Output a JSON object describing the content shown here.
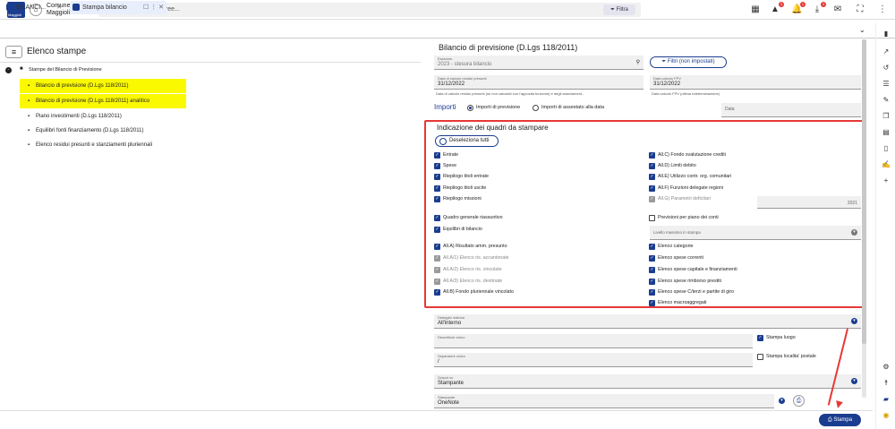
{
  "app": {
    "logo_text": "Maggioli",
    "name_line1": "Comune di",
    "name_line2": "Maggioli WEB",
    "search_placeholder": "Cerca in tutte le aree...",
    "filter_label": "Filtra",
    "badges": {
      "alerts": "3",
      "notifications": "1",
      "downloads": "3"
    }
  },
  "tabs": [
    {
      "label": "BILANCI..."
    },
    {
      "label": "Stampa bilancio"
    }
  ],
  "sidebar": {
    "title": "Elenco stampe",
    "root": "Stampe del Bilancio di Previsione",
    "items": [
      {
        "label": "Bilancio di previsione (D.Lgs 118/2011)"
      },
      {
        "label": "Bilancio di previsione (D.Lgs 118/2011) analitico"
      },
      {
        "label": "Piano investimenti (D.Lgs 118/2011)"
      },
      {
        "label": "Equilibri fonti finanziamento (D.Lgs 118/2011)"
      },
      {
        "label": "Elenco residui presunti e stanziamenti pluriennali"
      }
    ]
  },
  "form": {
    "title": "Bilancio di previsione (D.Lgs 118/2011)",
    "esercizio": {
      "label": "Esercizio",
      "value": "2023 - stesura bilancio"
    },
    "filter_btn": "Filtri (non impostati)",
    "residui": {
      "label": "Data di calcolo residui presunti",
      "value": "31/12/2022",
      "note": "Data di calcolo residui presunti (se non calcolati con l'apposita funzione) e degli stanziament..."
    },
    "fpv": {
      "label": "Data calcolo FPV",
      "value": "31/12/2022",
      "note": "Data calcolo FPV (ultima rideterminazione)"
    },
    "importi": {
      "label": "Importi",
      "opt1": "Importi di previsione",
      "opt2": "Importi di assestato alla data"
    },
    "data_label": "Data",
    "quadri": {
      "title": "Indicazione dei quadri da stampare",
      "deselect": "Deseleziona tutti",
      "left": [
        {
          "label": "Entrate",
          "state": "on"
        },
        {
          "label": "Spese",
          "state": "on"
        },
        {
          "label": "Riepilogo titoli entrate",
          "state": "on"
        },
        {
          "label": "Riepilogo titoli uscite",
          "state": "on"
        },
        {
          "label": "Riepilogo missioni",
          "state": "on"
        },
        {
          "label": "Quadro generale riassuntivo",
          "state": "on"
        },
        {
          "label": "Equilibri di bilancio",
          "state": "on"
        },
        {
          "label": "All.A) Risultato amm. presunto",
          "state": "on"
        },
        {
          "label": "All.A/1) Elenco ris. accantonate",
          "state": "dis"
        },
        {
          "label": "All.A/2) Elenco ris. vincolate",
          "state": "dis"
        },
        {
          "label": "All.A/3) Elenco ris. destinate",
          "state": "dis"
        },
        {
          "label": "All.B) Fondo pluriennale vincolato",
          "state": "on"
        }
      ],
      "right": [
        {
          "label": "All.C) Fondo svalutazione crediti",
          "state": "on"
        },
        {
          "label": "All.D) Limiti debito",
          "state": "on"
        },
        {
          "label": "All.E) Utilizzo contr. org. comunitari",
          "state": "on"
        },
        {
          "label": "All.F) Funzioni delegate regioni",
          "state": "on"
        },
        {
          "label": "All.G) Parametri deficitari",
          "state": "dis"
        },
        {
          "label": "Previsioni per piano dei conti",
          "state": "off"
        },
        {
          "label": "Elenco categorie",
          "state": "on"
        },
        {
          "label": "Elenco spese correnti",
          "state": "on"
        },
        {
          "label": "Elenco spese capitale e finanziamenti",
          "state": "on"
        },
        {
          "label": "Elenco spese rimborso prestiti",
          "state": "on"
        },
        {
          "label": "Elenco spese C/terzi e partite di giro",
          "state": "on"
        },
        {
          "label": "Elenco macroaggregati",
          "state": "on"
        }
      ],
      "year_value": "2021",
      "livello_label": "Livello massimo in stampa"
    },
    "dettaglio": {
      "label": "Dettaglio indirizzi",
      "value": "All'interno"
    },
    "stampa_luogo": "Stampa luogo",
    "descrittore": {
      "label": "Descrittore civico",
      "value": ""
    },
    "separatore": {
      "label": "Separatore civico",
      "value": "/"
    },
    "stampa_localita": "Stampa localita' postale",
    "output": {
      "label": "Output su",
      "value": "Stampante"
    },
    "stampante": {
      "label": "Stampante",
      "value": "OneNote"
    },
    "print_btn": "Stampa"
  },
  "colors": {
    "primary": "#1b3d8f",
    "highlight": "#fbf900",
    "annotation": "#e53935"
  }
}
